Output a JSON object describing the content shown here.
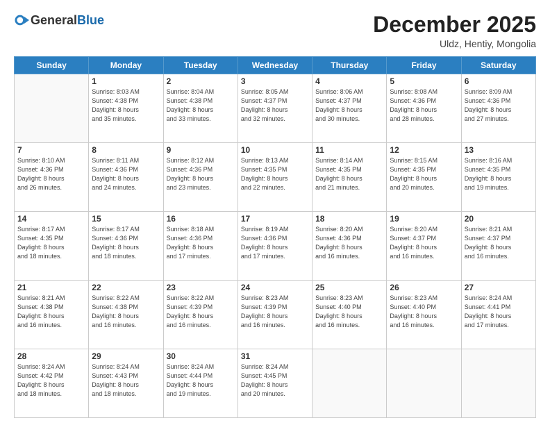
{
  "header": {
    "logo_general": "General",
    "logo_blue": "Blue",
    "month": "December 2025",
    "location": "Uldz, Hentiy, Mongolia"
  },
  "weekdays": [
    "Sunday",
    "Monday",
    "Tuesday",
    "Wednesday",
    "Thursday",
    "Friday",
    "Saturday"
  ],
  "weeks": [
    [
      {
        "day": "",
        "info": ""
      },
      {
        "day": "1",
        "info": "Sunrise: 8:03 AM\nSunset: 4:38 PM\nDaylight: 8 hours\nand 35 minutes."
      },
      {
        "day": "2",
        "info": "Sunrise: 8:04 AM\nSunset: 4:38 PM\nDaylight: 8 hours\nand 33 minutes."
      },
      {
        "day": "3",
        "info": "Sunrise: 8:05 AM\nSunset: 4:37 PM\nDaylight: 8 hours\nand 32 minutes."
      },
      {
        "day": "4",
        "info": "Sunrise: 8:06 AM\nSunset: 4:37 PM\nDaylight: 8 hours\nand 30 minutes."
      },
      {
        "day": "5",
        "info": "Sunrise: 8:08 AM\nSunset: 4:36 PM\nDaylight: 8 hours\nand 28 minutes."
      },
      {
        "day": "6",
        "info": "Sunrise: 8:09 AM\nSunset: 4:36 PM\nDaylight: 8 hours\nand 27 minutes."
      }
    ],
    [
      {
        "day": "7",
        "info": "Sunrise: 8:10 AM\nSunset: 4:36 PM\nDaylight: 8 hours\nand 26 minutes."
      },
      {
        "day": "8",
        "info": "Sunrise: 8:11 AM\nSunset: 4:36 PM\nDaylight: 8 hours\nand 24 minutes."
      },
      {
        "day": "9",
        "info": "Sunrise: 8:12 AM\nSunset: 4:36 PM\nDaylight: 8 hours\nand 23 minutes."
      },
      {
        "day": "10",
        "info": "Sunrise: 8:13 AM\nSunset: 4:35 PM\nDaylight: 8 hours\nand 22 minutes."
      },
      {
        "day": "11",
        "info": "Sunrise: 8:14 AM\nSunset: 4:35 PM\nDaylight: 8 hours\nand 21 minutes."
      },
      {
        "day": "12",
        "info": "Sunrise: 8:15 AM\nSunset: 4:35 PM\nDaylight: 8 hours\nand 20 minutes."
      },
      {
        "day": "13",
        "info": "Sunrise: 8:16 AM\nSunset: 4:35 PM\nDaylight: 8 hours\nand 19 minutes."
      }
    ],
    [
      {
        "day": "14",
        "info": "Sunrise: 8:17 AM\nSunset: 4:35 PM\nDaylight: 8 hours\nand 18 minutes."
      },
      {
        "day": "15",
        "info": "Sunrise: 8:17 AM\nSunset: 4:36 PM\nDaylight: 8 hours\nand 18 minutes."
      },
      {
        "day": "16",
        "info": "Sunrise: 8:18 AM\nSunset: 4:36 PM\nDaylight: 8 hours\nand 17 minutes."
      },
      {
        "day": "17",
        "info": "Sunrise: 8:19 AM\nSunset: 4:36 PM\nDaylight: 8 hours\nand 17 minutes."
      },
      {
        "day": "18",
        "info": "Sunrise: 8:20 AM\nSunset: 4:36 PM\nDaylight: 8 hours\nand 16 minutes."
      },
      {
        "day": "19",
        "info": "Sunrise: 8:20 AM\nSunset: 4:37 PM\nDaylight: 8 hours\nand 16 minutes."
      },
      {
        "day": "20",
        "info": "Sunrise: 8:21 AM\nSunset: 4:37 PM\nDaylight: 8 hours\nand 16 minutes."
      }
    ],
    [
      {
        "day": "21",
        "info": "Sunrise: 8:21 AM\nSunset: 4:38 PM\nDaylight: 8 hours\nand 16 minutes."
      },
      {
        "day": "22",
        "info": "Sunrise: 8:22 AM\nSunset: 4:38 PM\nDaylight: 8 hours\nand 16 minutes."
      },
      {
        "day": "23",
        "info": "Sunrise: 8:22 AM\nSunset: 4:39 PM\nDaylight: 8 hours\nand 16 minutes."
      },
      {
        "day": "24",
        "info": "Sunrise: 8:23 AM\nSunset: 4:39 PM\nDaylight: 8 hours\nand 16 minutes."
      },
      {
        "day": "25",
        "info": "Sunrise: 8:23 AM\nSunset: 4:40 PM\nDaylight: 8 hours\nand 16 minutes."
      },
      {
        "day": "26",
        "info": "Sunrise: 8:23 AM\nSunset: 4:40 PM\nDaylight: 8 hours\nand 16 minutes."
      },
      {
        "day": "27",
        "info": "Sunrise: 8:24 AM\nSunset: 4:41 PM\nDaylight: 8 hours\nand 17 minutes."
      }
    ],
    [
      {
        "day": "28",
        "info": "Sunrise: 8:24 AM\nSunset: 4:42 PM\nDaylight: 8 hours\nand 18 minutes."
      },
      {
        "day": "29",
        "info": "Sunrise: 8:24 AM\nSunset: 4:43 PM\nDaylight: 8 hours\nand 18 minutes."
      },
      {
        "day": "30",
        "info": "Sunrise: 8:24 AM\nSunset: 4:44 PM\nDaylight: 8 hours\nand 19 minutes."
      },
      {
        "day": "31",
        "info": "Sunrise: 8:24 AM\nSunset: 4:45 PM\nDaylight: 8 hours\nand 20 minutes."
      },
      {
        "day": "",
        "info": ""
      },
      {
        "day": "",
        "info": ""
      },
      {
        "day": "",
        "info": ""
      }
    ]
  ]
}
